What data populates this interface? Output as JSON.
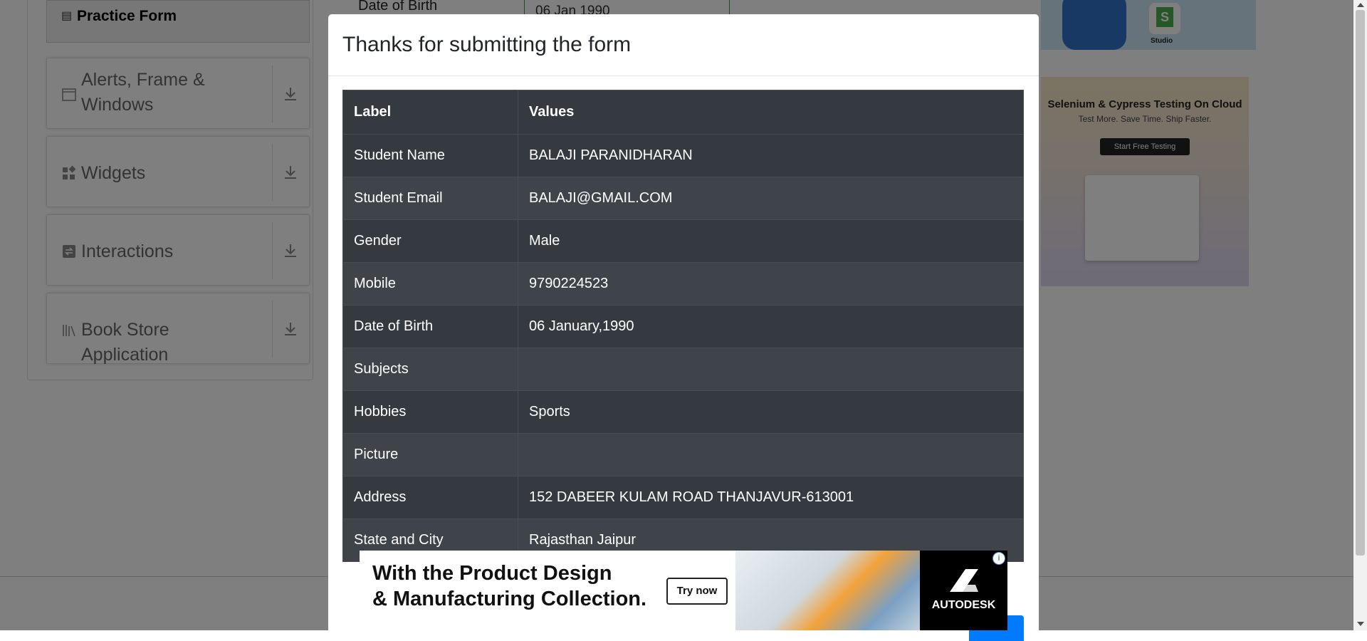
{
  "sidebar": {
    "practice_form": "Practice Form",
    "groups": [
      {
        "label": "Alerts, Frame & Windows",
        "icon": "window-icon"
      },
      {
        "label": "Widgets",
        "icon": "widgets-icon"
      },
      {
        "label": "Interactions",
        "icon": "interactions-icon"
      },
      {
        "label": "Book Store Application",
        "icon": "books-icon"
      }
    ]
  },
  "background_form": {
    "dob_label": "Date of Birth",
    "dob_value": "06 Jan 1990"
  },
  "ads": {
    "studio_label": "Studio",
    "badge_letter": "S",
    "selenium_title": "Selenium & Cypress Testing On Cloud",
    "selenium_subtitle": "Test More. Save Time. Ship Faster.",
    "selenium_button": "Start Free Testing",
    "bottom_line1": "With the Product Design",
    "bottom_line2": "& Manufacturing Collection.",
    "bottom_button": "Try now",
    "bottom_brand": "AUTODESK"
  },
  "modal": {
    "title": "Thanks for submitting the form",
    "headers": [
      "Label",
      "Values"
    ],
    "rows": [
      [
        "Student Name",
        "BALAJI PARANIDHARAN"
      ],
      [
        "Student Email",
        "BALAJI@GMAIL.COM"
      ],
      [
        "Gender",
        "Male"
      ],
      [
        "Mobile",
        "9790224523"
      ],
      [
        "Date of Birth",
        "06 January,1990"
      ],
      [
        "Subjects",
        ""
      ],
      [
        "Hobbies",
        "Sports"
      ],
      [
        "Picture",
        ""
      ],
      [
        "Address",
        "152 DABEER KULAM ROAD THANJAVUR-613001"
      ],
      [
        "State and City",
        "Rajasthan Jaipur"
      ]
    ]
  },
  "colors": {
    "table_dark": "#343a40",
    "table_stripe": "#3e444a",
    "primary": "#007bff",
    "success": "#28a745"
  }
}
